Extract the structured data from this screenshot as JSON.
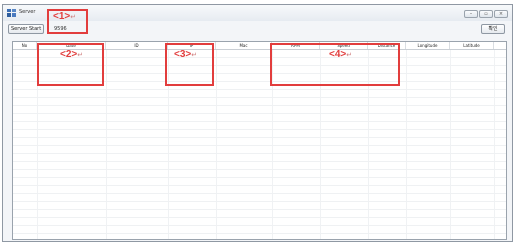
{
  "window": {
    "title": "Server"
  },
  "toolbar": {
    "server_start_label": "Server Start",
    "right_button_label": "확인",
    "port_value": "9596"
  },
  "columns": [
    "No",
    "Date",
    "ID",
    "IP",
    "Mac",
    "RPM",
    "Speed",
    "Distance",
    "Longitude",
    "Latitude"
  ],
  "callouts": {
    "c1": {
      "label": "<1>",
      "mark": "↵"
    },
    "c2": {
      "label": "<2>",
      "mark": "↵"
    },
    "c3": {
      "label": "<3>",
      "mark": "↵"
    },
    "c4": {
      "label": "<4>",
      "mark": "↵"
    }
  },
  "colors": {
    "callout": "#e23d3d",
    "window_border": "#8f98a3",
    "grid_bg": "#ffffff"
  }
}
